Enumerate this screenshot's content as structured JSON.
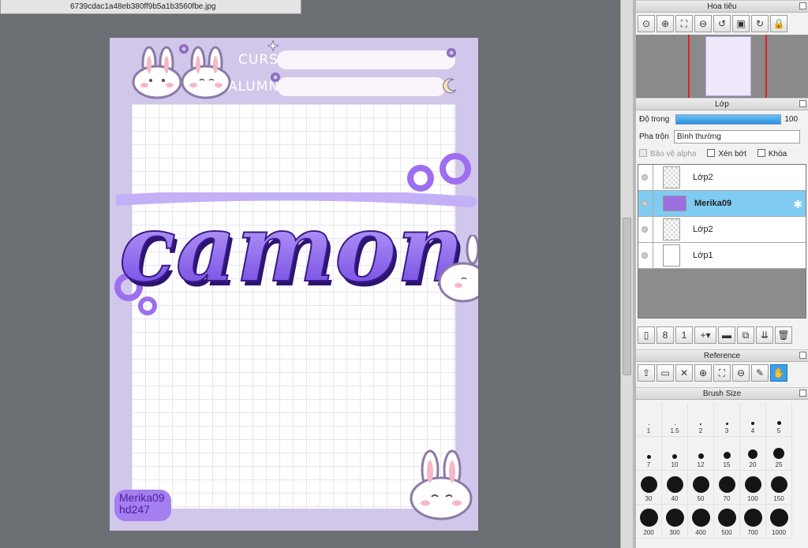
{
  "canvas": {
    "file_name": "6739cdac1a48eb380ff9b5a1b3560fbe.jpg",
    "page": {
      "label_course": "CURSO:",
      "label_student": "ALUMNO:",
      "title_text": "camon",
      "signature_line1": "Merika09",
      "signature_line2": "hd247"
    }
  },
  "navigator": {
    "title": "Hoa tiêu",
    "tools": [
      "zoom-actual-icon",
      "zoom-in-icon",
      "fit-icon",
      "zoom-out-icon",
      "rotate-left-icon",
      "flip-icon",
      "rotate-right-icon",
      "lock-icon"
    ]
  },
  "layer_panel": {
    "title": "Lớp",
    "opacity_label": "Độ trong",
    "opacity_value": "100",
    "blend_label": "Pha trộn",
    "blend_value": "Bình thường",
    "protect_alpha": "Bảo vệ alpha",
    "clipping": "Xén bớt",
    "lock": "Khóa",
    "layers": [
      {
        "name": "Lớp2",
        "selected": false
      },
      {
        "name": "Merika09",
        "selected": true
      },
      {
        "name": "Lớp2",
        "selected": false
      },
      {
        "name": "Lớp1",
        "selected": false
      }
    ]
  },
  "reference_panel": {
    "title": "Reference"
  },
  "brush_panel": {
    "title": "Brush Size",
    "sizes": [
      "1",
      "1.5",
      "2",
      "3",
      "4",
      "5",
      "7",
      "10",
      "12",
      "15",
      "20",
      "25",
      "30",
      "40",
      "50",
      "70",
      "100",
      "150",
      "200",
      "300",
      "400",
      "500",
      "700",
      "1000"
    ]
  },
  "colors": {
    "accent": "#3aa0e8",
    "page_bg": "#d1c7ea",
    "title_purple": "#7b4fe0"
  }
}
